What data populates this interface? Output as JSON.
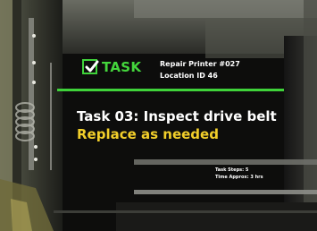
{
  "hud": {
    "task_badge": "TASK",
    "repair_title": "Repair Printer #027",
    "location": "Location ID 46",
    "task_title": "Task 03: Inspect drive belt",
    "task_instruction": "Replace as needed",
    "task_steps": "Task Steps: 5",
    "time_approx": "Time Approx: 3 hrs"
  },
  "colors": {
    "accent_green": "#3fd23a",
    "instruction_yellow": "#f2cf2a"
  },
  "icons": {
    "task_icon": "checkbox-checked-icon"
  }
}
